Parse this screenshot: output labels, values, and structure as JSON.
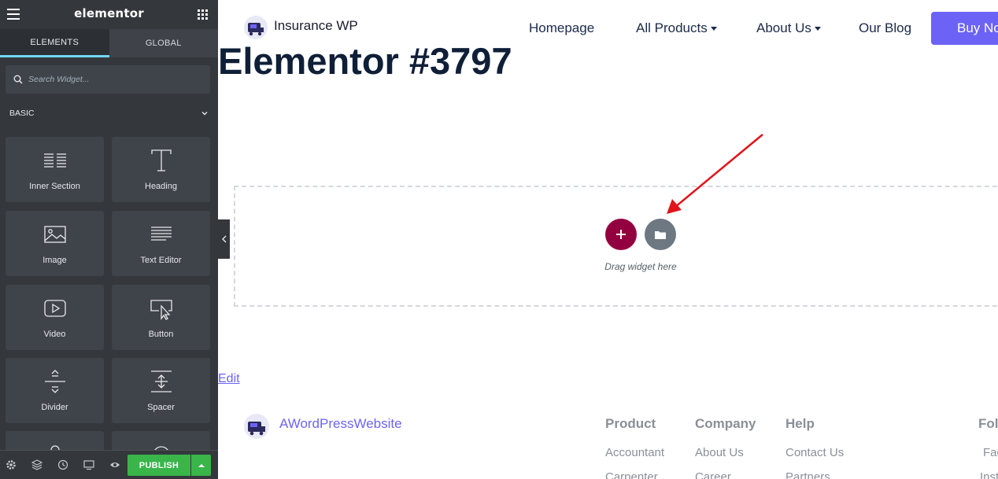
{
  "sidebar": {
    "brand": "elementor",
    "tabs": [
      "ELEMENTS",
      "GLOBAL"
    ],
    "search_placeholder": "Search Widget...",
    "category": "BASIC",
    "widgets": [
      {
        "label": "Inner Section",
        "icon": "inner-section-icon"
      },
      {
        "label": "Heading",
        "icon": "heading-icon"
      },
      {
        "label": "Image",
        "icon": "image-icon"
      },
      {
        "label": "Text Editor",
        "icon": "text-editor-icon"
      },
      {
        "label": "Video",
        "icon": "video-icon"
      },
      {
        "label": "Button",
        "icon": "button-icon"
      },
      {
        "label": "Divider",
        "icon": "divider-icon"
      },
      {
        "label": "Spacer",
        "icon": "spacer-icon"
      }
    ],
    "footer": {
      "publish_label": "PUBLISH",
      "icons": [
        "settings-icon",
        "navigator-icon",
        "history-icon",
        "responsive-icon",
        "preview-icon"
      ]
    }
  },
  "site": {
    "name": "Insurance WP",
    "nav": [
      {
        "label": "Homepage",
        "dropdown": false
      },
      {
        "label": "All Products",
        "dropdown": true
      },
      {
        "label": "About Us",
        "dropdown": true
      },
      {
        "label": "Our Blog",
        "dropdown": false
      }
    ],
    "cta": "Buy Now",
    "accent": "#6c63f6"
  },
  "page": {
    "title": "Elementor #3797",
    "drop_hint": "Drag widget here",
    "edit_link": "Edit"
  },
  "footer": {
    "brand": "AWordPressWebsite",
    "columns": [
      {
        "heading": "Product",
        "links": [
          "Accountant",
          "Carpenter"
        ]
      },
      {
        "heading": "Company",
        "links": [
          "About Us",
          "Career"
        ]
      },
      {
        "heading": "Help",
        "links": [
          "Contact Us",
          "Partners"
        ]
      },
      {
        "heading": "Follow",
        "links": [
          "Facebook",
          "Instagram"
        ]
      }
    ]
  },
  "colors": {
    "add_button": "#93003f",
    "template_button": "#6d7882",
    "publish": "#39b54a",
    "annotation_arrow": "#e0141a"
  }
}
